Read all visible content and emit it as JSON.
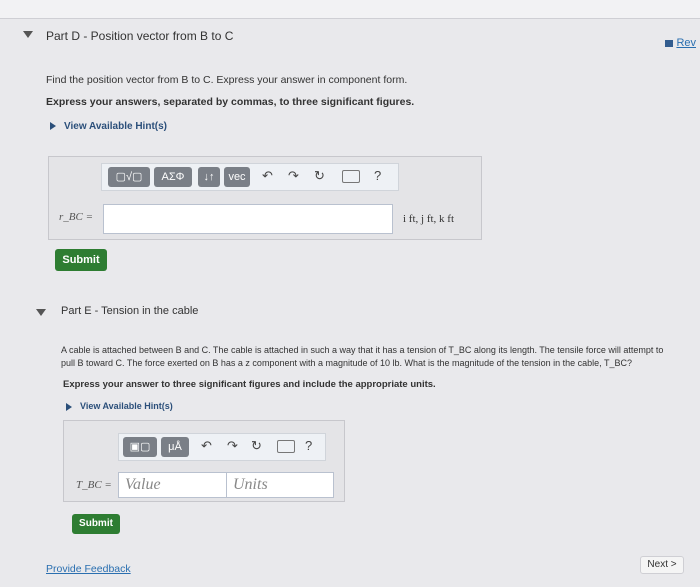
{
  "partD": {
    "title": "Part D - Position vector from B to C",
    "review": "Rev",
    "question": "Find the position vector from B to C. Express your answer in component form.",
    "instruction": "Express your answers, separated by commas, to three significant figures.",
    "hint_link": "View Available Hint(s)",
    "toolbar": {
      "templates": "▢√▢",
      "greek": "ΑΣΦ",
      "updown": "↓↑",
      "vec": "vec",
      "help": "?"
    },
    "input_label": "r_BC =",
    "input_value": "",
    "units": "i ft, j ft, k ft",
    "submit_label": "Submit"
  },
  "partE": {
    "title": "Part E - Tension in the cable",
    "question_line1": "A cable is attached between B and C. The cable is attached in such a way that it has a tension of T_BC along its length. The tensile force will attempt to",
    "question_line2": "pull B toward C. The force exerted on B has a z component with a magnitude of 10 lb. What is the magnitude of the tension in the cable, T_BC?",
    "instruction": "Express your answer to three significant figures and include the appropriate units.",
    "hint_link": "View Available Hint(s)",
    "toolbar": {
      "units_btn": "μÅ",
      "help": "?"
    },
    "input_label": "T_BC =",
    "value_placeholder": "Value",
    "units_placeholder": "Units",
    "submit_label": "Submit"
  },
  "footer": {
    "feedback": "Provide Feedback",
    "next": "Next >"
  }
}
